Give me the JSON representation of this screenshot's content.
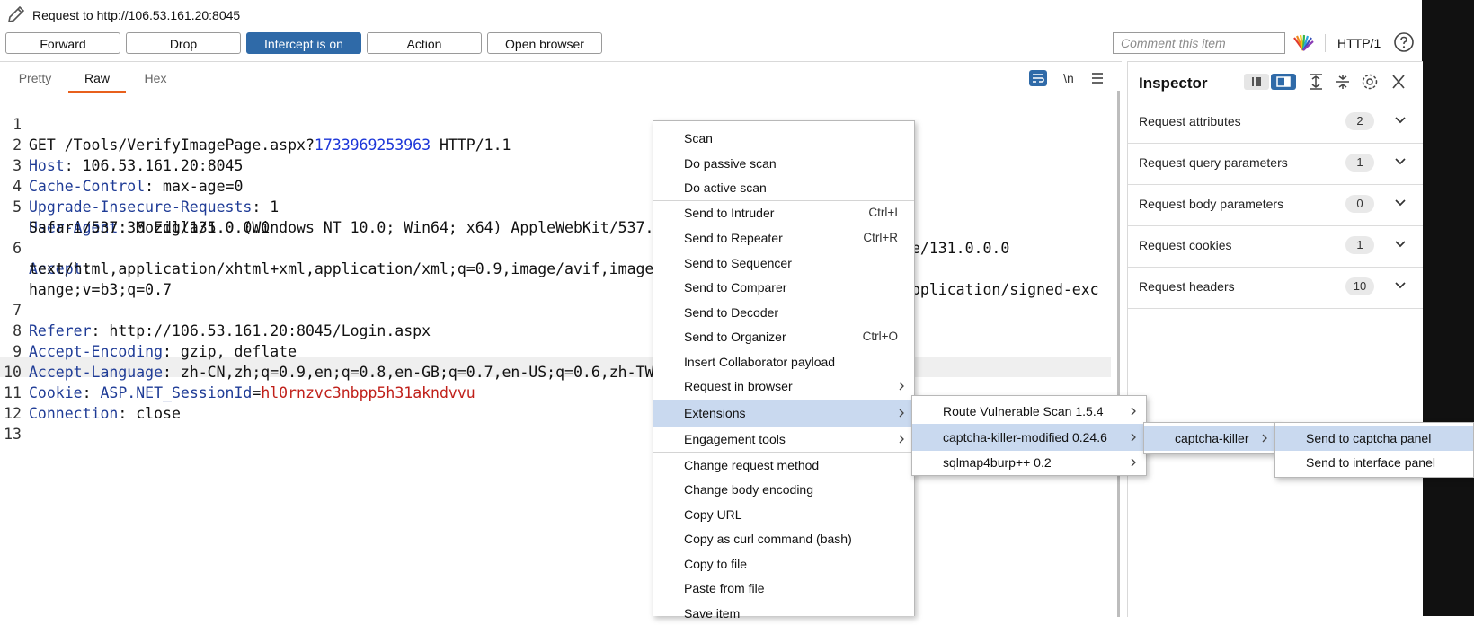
{
  "window": {
    "title": "Request to http://106.53.161.20:8045"
  },
  "toolbar": {
    "forward": "Forward",
    "drop": "Drop",
    "intercept": "Intercept is on",
    "action": "Action",
    "open_browser": "Open browser",
    "comment_placeholder": "Comment this item",
    "http_version": "HTTP/1",
    "accent_color": "#2f6aa8"
  },
  "editor": {
    "tabs": [
      "Pretty",
      "Raw",
      "Hex"
    ],
    "selected_tab": "Raw",
    "newline_toggle": "\\n",
    "line_numbers": [
      "1",
      "2",
      "3",
      "4",
      "5",
      "6",
      "7",
      "8",
      "9",
      "10",
      "11",
      "12",
      "13"
    ],
    "lines": {
      "l1": {
        "method": "GET /Tools/VerifyImagePage.aspx?",
        "query": "1733969253963",
        "proto": " HTTP/1.1"
      },
      "l2": {
        "name": "Host",
        "value": ": 106.53.161.20:8045"
      },
      "l3": {
        "name": "Cache-Control",
        "value": ": max-age=0"
      },
      "l4": {
        "name": "Upgrade-Insecure-Requests",
        "value": ": 1"
      },
      "l5": {
        "name": "User-Agent",
        "value": ": Mozilla/5.0 (Windows NT 10.0; Win64; x64) AppleWebKit/537.",
        "value_tail": "e/131.0.0.0"
      },
      "l5b": "Safari/537.36 Edg/131.0.0.0",
      "l6": {
        "name": "Accept",
        "value": ":"
      },
      "l6b": {
        "head": "text/html,application/xhtml+xml,application/xml;q=0.9,image/avif,image",
        "tail": "pplication/signed-exc"
      },
      "l6c": "hange;v=b3;q=0.7",
      "l7": {
        "name": "Referer",
        "value": ": http://106.53.161.20:8045/Login.aspx"
      },
      "l8": {
        "name": "Accept-Encoding",
        "value": ": gzip, deflate"
      },
      "l9": {
        "name": "Accept-Language",
        "value": ": zh-CN,zh;q=0.9,en;q=0.8,en-GB;q=0.7,en-US;q=0.6,zh-TW"
      },
      "l10": {
        "name": "Cookie",
        "value": ": ",
        "cname": "ASP.NET_SessionId",
        "eq": "=",
        "cval": "hl0rnzvc3nbpp5h31akndvvu"
      },
      "l11": {
        "name": "Connection",
        "value": ": close"
      }
    }
  },
  "inspector": {
    "title": "Inspector",
    "sections": [
      {
        "label": "Request attributes",
        "count": "2"
      },
      {
        "label": "Request query parameters",
        "count": "1"
      },
      {
        "label": "Request body parameters",
        "count": "0"
      },
      {
        "label": "Request cookies",
        "count": "1"
      },
      {
        "label": "Request headers",
        "count": "10"
      }
    ]
  },
  "context_menu": {
    "items": [
      {
        "label": "Scan"
      },
      {
        "label": "Do passive scan"
      },
      {
        "label": "Do active scan"
      },
      {
        "label": "Send to Intruder",
        "shortcut": "Ctrl+I"
      },
      {
        "label": "Send to Repeater",
        "shortcut": "Ctrl+R"
      },
      {
        "label": "Send to Sequencer"
      },
      {
        "label": "Send to Comparer"
      },
      {
        "label": "Send to Decoder"
      },
      {
        "label": "Send to Organizer",
        "shortcut": "Ctrl+O"
      },
      {
        "label": "Insert Collaborator payload"
      },
      {
        "label": "Request in browser"
      },
      {
        "label": "Extensions"
      },
      {
        "label": "Engagement tools"
      },
      {
        "label": "Change request method"
      },
      {
        "label": "Change body encoding"
      },
      {
        "label": "Copy URL"
      },
      {
        "label": "Copy as curl command (bash)"
      },
      {
        "label": "Copy to file"
      },
      {
        "label": "Paste from file"
      },
      {
        "label": "Save item"
      }
    ],
    "highlight_color": "#c9d9ef"
  },
  "extensions_menu": {
    "items": [
      {
        "label": "Route Vulnerable Scan 1.5.4"
      },
      {
        "label": "captcha-killer-modified 0.24.6"
      },
      {
        "label": "sqlmap4burp++ 0.2"
      }
    ]
  },
  "captcha_menu": {
    "items": [
      {
        "label": "captcha-killer"
      }
    ]
  },
  "captcha_killer_menu": {
    "items": [
      {
        "label": "Send to captcha panel"
      },
      {
        "label": "Send to interface panel"
      }
    ]
  }
}
